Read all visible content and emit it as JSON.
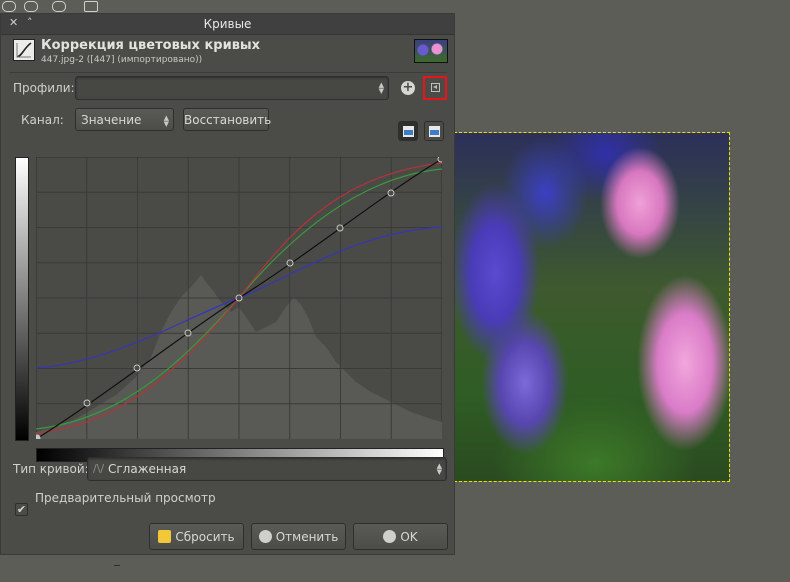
{
  "window": {
    "title": "Кривые",
    "header_title": "Коррекция цветовых кривых",
    "header_subtitle": "447.jpg-2 ([447] (импортировано))"
  },
  "profiles": {
    "label": "Профили:",
    "value": ""
  },
  "channel": {
    "label": "Канал:",
    "value": "Значение",
    "reset_label": "Восстановить"
  },
  "curve_type": {
    "label": "Тип кривой:",
    "value": "Сглаженная"
  },
  "preview": {
    "label": "Предварительный просмотр",
    "checked": true
  },
  "buttons": {
    "reset": "Сбросить",
    "cancel": "Отменить",
    "ok": "OK"
  },
  "colors": {
    "red_curve": "#b0353a",
    "green_curve": "#3a9a3a",
    "blue_curve": "#3536b8",
    "value_curve": "#101010",
    "highlight": "#e8141a",
    "selection": "#e6e600"
  },
  "icons": {
    "add_profile": "plus-circle-icon",
    "profile_menu": "menu-arrow-icon",
    "linear_histogram": "linear-histogram-icon",
    "log_histogram": "log-histogram-icon",
    "reset": "reset-icon",
    "cancel": "cancel-icon",
    "ok": "ok-icon"
  }
}
